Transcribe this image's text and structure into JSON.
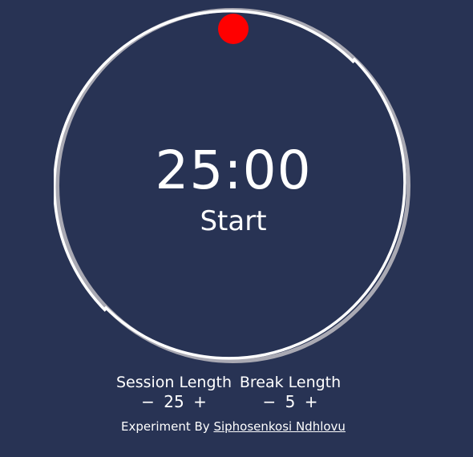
{
  "timer": {
    "time": "25:00",
    "action_label": "Start",
    "progress": 0
  },
  "session": {
    "label": "Session Length",
    "decrement": "−",
    "value": "25",
    "increment": "+"
  },
  "break": {
    "label": "Break Length",
    "decrement": "−",
    "value": "5",
    "increment": "+"
  },
  "footer": {
    "prefix": "Experiment By",
    "author": "Siphosenkosi Ndhlovu"
  },
  "colors": {
    "background": "#283354",
    "ring": "#ffffff",
    "ring_shadow": "#a9a9b3",
    "handle": "#ff0000"
  }
}
